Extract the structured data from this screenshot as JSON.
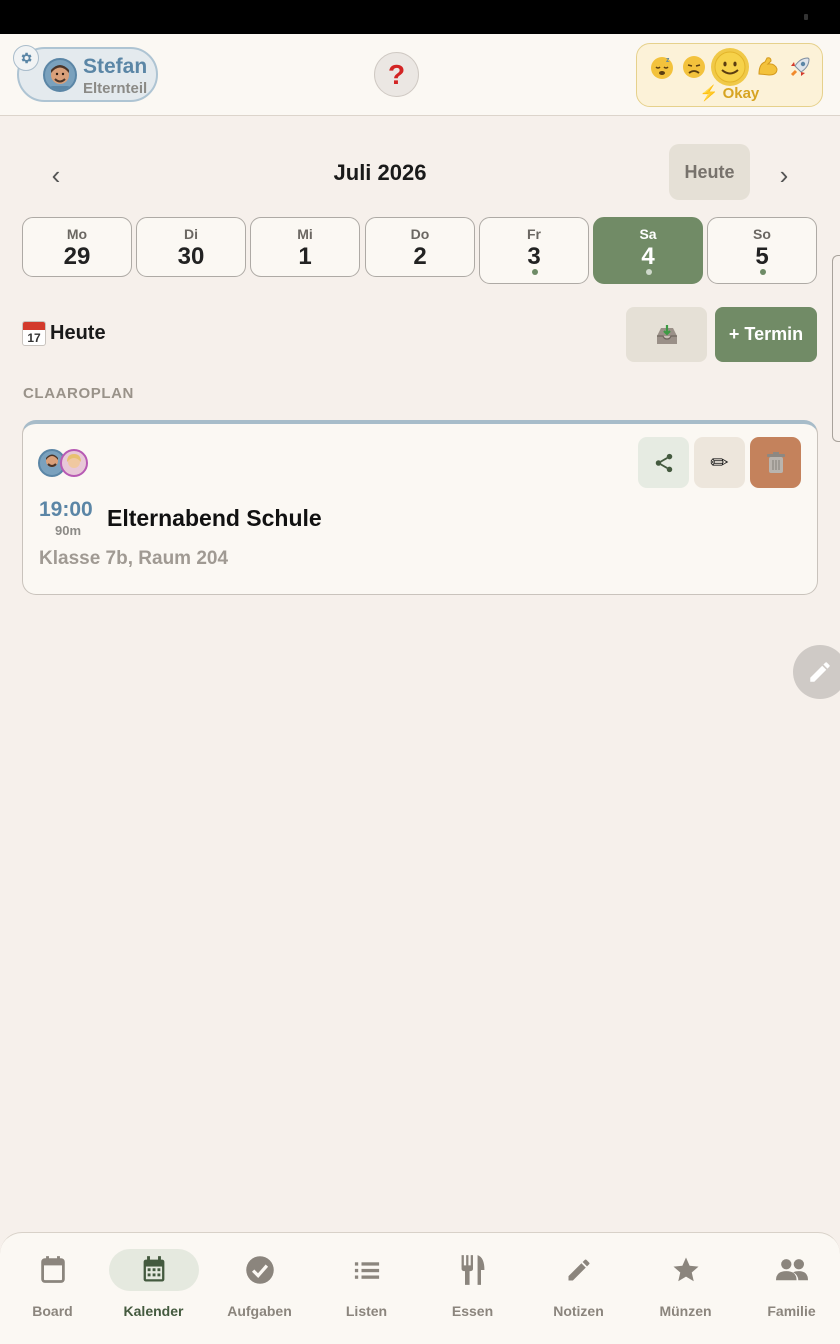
{
  "header": {
    "profile": {
      "name": "Stefan",
      "role": "Elternteil"
    },
    "help_label": "?",
    "mood": {
      "options": [
        "sleepy-face",
        "sad-face",
        "smiling-face",
        "flexed-biceps",
        "rocket"
      ],
      "selected_index": 2,
      "label": "⚡ Okay"
    }
  },
  "calendar": {
    "month_title": "Juli 2026",
    "today_button": "Heute",
    "prev_label": "‹",
    "next_label": "›",
    "days": [
      {
        "name": "Mo",
        "num": "29",
        "has_event": false,
        "selected": false
      },
      {
        "name": "Di",
        "num": "30",
        "has_event": false,
        "selected": false
      },
      {
        "name": "Mi",
        "num": "1",
        "has_event": false,
        "selected": false
      },
      {
        "name": "Do",
        "num": "2",
        "has_event": false,
        "selected": false
      },
      {
        "name": "Fr",
        "num": "3",
        "has_event": true,
        "selected": false
      },
      {
        "name": "Sa",
        "num": "4",
        "has_event": true,
        "selected": true
      },
      {
        "name": "So",
        "num": "5",
        "has_event": true,
        "selected": false
      }
    ]
  },
  "section": {
    "icon_num": "17",
    "title": "Heute",
    "add_button": "+ Termin",
    "group_label": "CLAAROPLAN"
  },
  "event": {
    "time": "19:00",
    "duration": "90m",
    "title": "Elternabend Schule",
    "location": "Klasse 7b, Raum 204",
    "edit_glyph": "✏"
  },
  "bottom_nav": [
    {
      "label": "Board",
      "icon": "calendar-outline-icon",
      "active": false
    },
    {
      "label": "Kalender",
      "icon": "calendar-grid-icon",
      "active": true
    },
    {
      "label": "Aufgaben",
      "icon": "check-circle-icon",
      "active": false
    },
    {
      "label": "Listen",
      "icon": "list-icon",
      "active": false
    },
    {
      "label": "Essen",
      "icon": "fork-knife-icon",
      "active": false
    },
    {
      "label": "Notizen",
      "icon": "pencil-icon",
      "active": false
    },
    {
      "label": "Münzen",
      "icon": "star-icon",
      "active": false
    },
    {
      "label": "Familie",
      "icon": "people-icon",
      "active": false
    }
  ],
  "colors": {
    "accent_green": "#718b66",
    "accent_blue": "#5b86a6",
    "background": "#f6f0eb",
    "delete_button": "#c4825c"
  }
}
